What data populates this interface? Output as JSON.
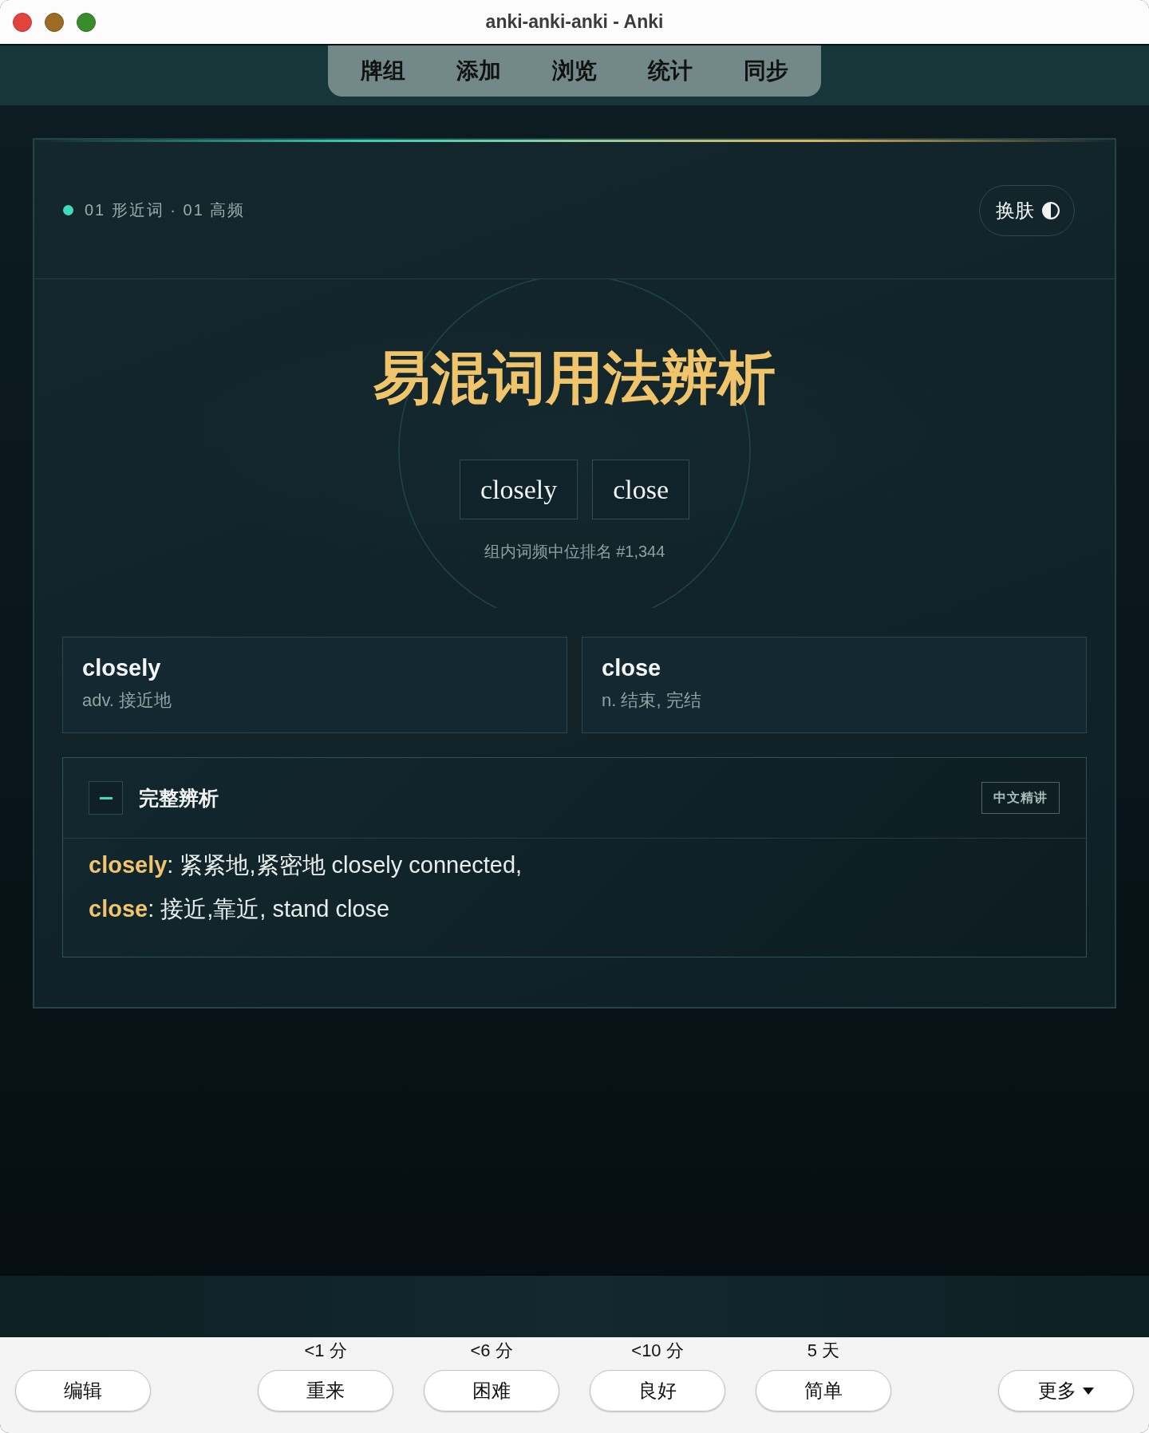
{
  "window": {
    "title": "anki-anki-anki - Anki"
  },
  "toolbar": {
    "items": [
      {
        "label": "牌组"
      },
      {
        "label": "添加"
      },
      {
        "label": "浏览"
      },
      {
        "label": "统计"
      },
      {
        "label": "同步"
      }
    ]
  },
  "card": {
    "tag": "01 形近词 · 01 高频",
    "skin_button": {
      "label": "换肤"
    },
    "title": "易混词用法辨析",
    "words": [
      "closely",
      "close"
    ],
    "rank": "组内词频中位排名 #1,344",
    "definitions": [
      {
        "word": "closely",
        "meaning": "adv. 接近地"
      },
      {
        "word": "close",
        "meaning": "n. 结束, 完结"
      }
    ],
    "analysis": {
      "title": "完整辨析",
      "expanded": true,
      "badge": "中文精讲",
      "lines": [
        "**closely**: 紧紧地,紧密地 closely connected,",
        "**close**: 接近,靠近, stand close"
      ]
    }
  },
  "answer_bar": {
    "edit_button": "编辑",
    "answers": [
      {
        "due": "<1 分",
        "label": "重来"
      },
      {
        "due": "<6 分",
        "label": "困难"
      },
      {
        "due": "<10 分",
        "label": "良好"
      },
      {
        "due": "5 天",
        "label": "简单"
      }
    ],
    "more_button": "更多"
  }
}
